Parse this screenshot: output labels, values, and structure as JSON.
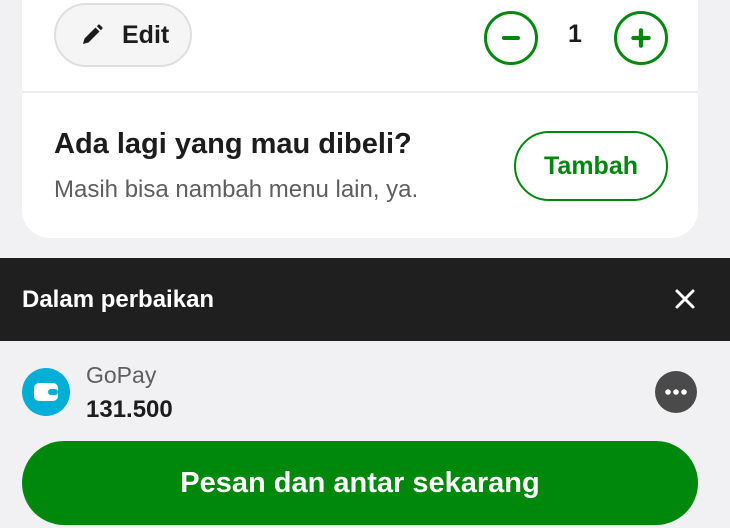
{
  "item": {
    "edit_label": "Edit",
    "quantity": "1"
  },
  "upsell": {
    "title": "Ada lagi yang mau dibeli?",
    "subtitle": "Masih bisa nambah menu lain, ya.",
    "add_label": "Tambah"
  },
  "banner": {
    "text": "Dalam perbaikan"
  },
  "payment": {
    "method": "GoPay",
    "balance": "131.500"
  },
  "order": {
    "button_label": "Pesan dan antar sekarang"
  },
  "colors": {
    "brand_green": "#00880d",
    "banner_bg": "#1f1f1f",
    "wallet_blue": "#00aed6"
  },
  "icons": {
    "edit": "pencil-icon",
    "decrease": "minus-icon",
    "increase": "plus-icon",
    "close": "close-icon",
    "wallet": "wallet-icon",
    "more": "more-icon"
  }
}
